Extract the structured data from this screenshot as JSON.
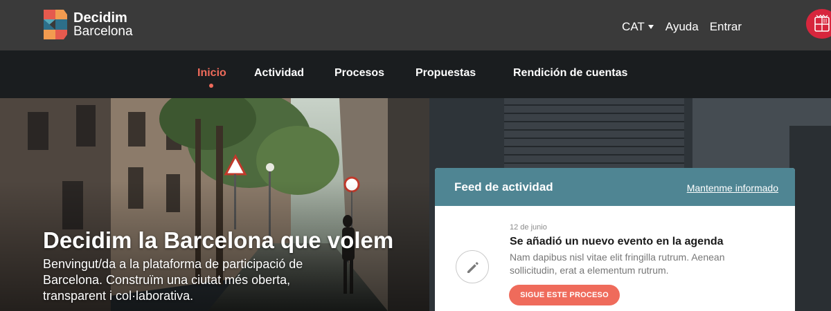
{
  "brand": {
    "name_line1": "Decidim",
    "name_line2": "Barcelona"
  },
  "top_links": {
    "language": "CAT",
    "help": "Ayuda",
    "login": "Entrar"
  },
  "nav": {
    "items": [
      {
        "label": "Inicio",
        "active": true
      },
      {
        "label": "Actividad"
      },
      {
        "label": "Procesos"
      },
      {
        "label": "Propuestas"
      },
      {
        "label": "Rendición de cuentas"
      }
    ]
  },
  "hero": {
    "title": "Decidim la Barcelona que volem",
    "subtitle": "Benvingut/da a la plataforma de participació de Barcelona. Construïm una ciutat més oberta, transparent i col·laborativa."
  },
  "feed": {
    "title": "Feed de actividad",
    "subscribe_link": "Mantenme informado",
    "item": {
      "date": "12 de junio",
      "title": "Se añadió un nuevo evento en la agenda",
      "text": "Nam dapibus nisl vitae elit fringilla rutrum. Aenean sollicitudin, erat a elementum rutrum.",
      "button": "SIGUE ESTE PROCESO",
      "icon": "pencil-icon"
    }
  },
  "colors": {
    "accent": "#ef6b5b",
    "feed_header": "#4f8593",
    "topbar": "#3a3a3a",
    "navbar": "#1a1d1f",
    "city_seal": "#d7263d"
  }
}
